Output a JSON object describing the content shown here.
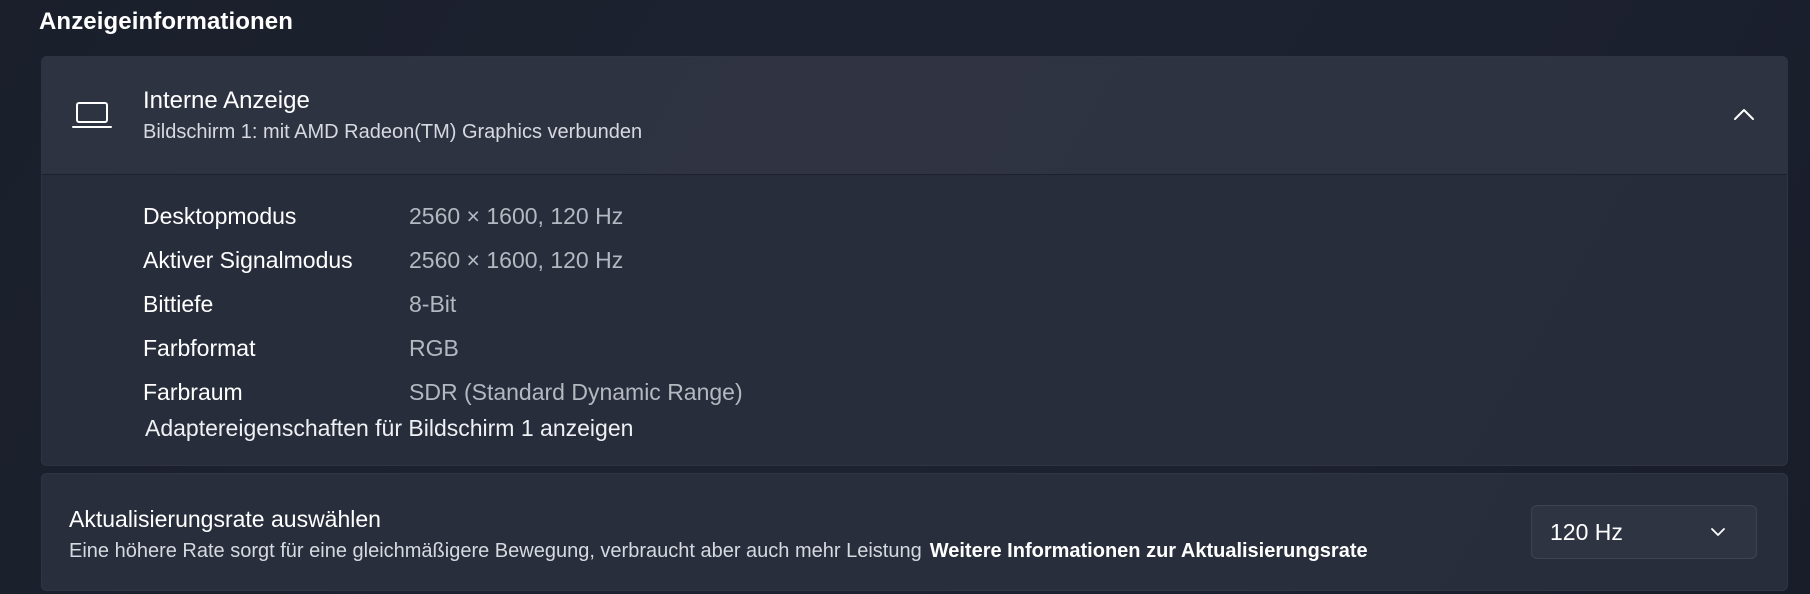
{
  "section": {
    "title": "Anzeigeinformationen"
  },
  "display": {
    "name": "Interne Anzeige",
    "subtitle": "Bildschirm 1: mit AMD Radeon(TM) Graphics verbunden",
    "icon": "laptop-icon",
    "expanded": true,
    "collapse_icon": "chevron-up-icon",
    "info": [
      {
        "label": "Desktopmodus",
        "value": "2560 × 1600, 120 Hz"
      },
      {
        "label": "Aktiver Signalmodus",
        "value": "2560 × 1600, 120 Hz"
      },
      {
        "label": "Bittiefe",
        "value": "8-Bit"
      },
      {
        "label": "Farbformat",
        "value": "RGB"
      },
      {
        "label": "Farbraum",
        "value": "SDR (Standard Dynamic Range)"
      }
    ],
    "adapter_link": "Adaptereigenschaften für Bildschirm 1 anzeigen"
  },
  "refresh": {
    "title": "Aktualisierungsrate auswählen",
    "description": "Eine höhere Rate sorgt für eine gleichmäßigere Bewegung, verbraucht aber auch mehr Leistung",
    "link": "Weitere Informationen zur Aktualisierungsrate",
    "selected": "120 Hz",
    "dropdown_icon": "chevron-down-icon"
  },
  "colors": {
    "background": "#1b2030",
    "card": "#2c3240",
    "text_primary": "#ffffff",
    "text_secondary": "#b4b8c0"
  }
}
